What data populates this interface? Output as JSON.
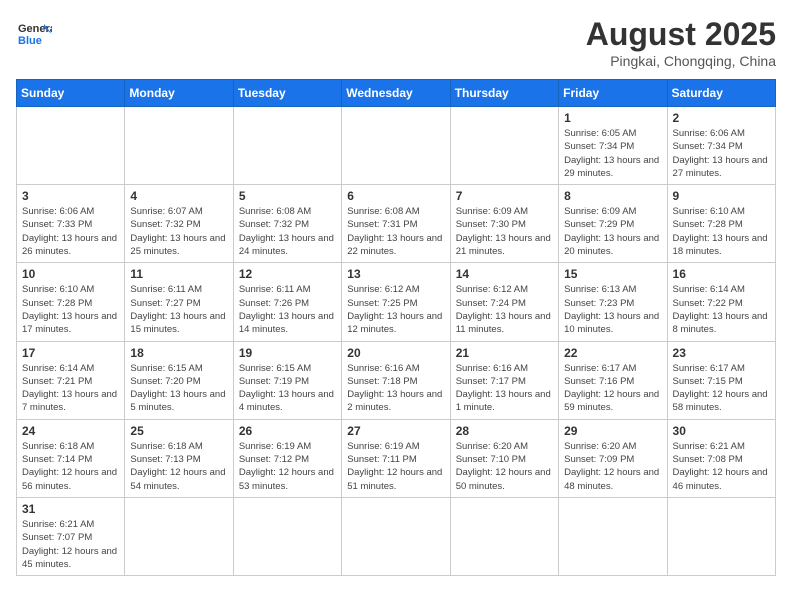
{
  "logo": {
    "text_general": "General",
    "text_blue": "Blue"
  },
  "header": {
    "title": "August 2025",
    "subtitle": "Pingkai, Chongqing, China"
  },
  "weekdays": [
    "Sunday",
    "Monday",
    "Tuesday",
    "Wednesday",
    "Thursday",
    "Friday",
    "Saturday"
  ],
  "days": [
    {
      "date": "",
      "info": ""
    },
    {
      "date": "",
      "info": ""
    },
    {
      "date": "",
      "info": ""
    },
    {
      "date": "",
      "info": ""
    },
    {
      "date": "",
      "info": ""
    },
    {
      "date": "1",
      "info": "Sunrise: 6:05 AM\nSunset: 7:34 PM\nDaylight: 13 hours and 29 minutes."
    },
    {
      "date": "2",
      "info": "Sunrise: 6:06 AM\nSunset: 7:34 PM\nDaylight: 13 hours and 27 minutes."
    },
    {
      "date": "3",
      "info": "Sunrise: 6:06 AM\nSunset: 7:33 PM\nDaylight: 13 hours and 26 minutes."
    },
    {
      "date": "4",
      "info": "Sunrise: 6:07 AM\nSunset: 7:32 PM\nDaylight: 13 hours and 25 minutes."
    },
    {
      "date": "5",
      "info": "Sunrise: 6:08 AM\nSunset: 7:32 PM\nDaylight: 13 hours and 24 minutes."
    },
    {
      "date": "6",
      "info": "Sunrise: 6:08 AM\nSunset: 7:31 PM\nDaylight: 13 hours and 22 minutes."
    },
    {
      "date": "7",
      "info": "Sunrise: 6:09 AM\nSunset: 7:30 PM\nDaylight: 13 hours and 21 minutes."
    },
    {
      "date": "8",
      "info": "Sunrise: 6:09 AM\nSunset: 7:29 PM\nDaylight: 13 hours and 20 minutes."
    },
    {
      "date": "9",
      "info": "Sunrise: 6:10 AM\nSunset: 7:28 PM\nDaylight: 13 hours and 18 minutes."
    },
    {
      "date": "10",
      "info": "Sunrise: 6:10 AM\nSunset: 7:28 PM\nDaylight: 13 hours and 17 minutes."
    },
    {
      "date": "11",
      "info": "Sunrise: 6:11 AM\nSunset: 7:27 PM\nDaylight: 13 hours and 15 minutes."
    },
    {
      "date": "12",
      "info": "Sunrise: 6:11 AM\nSunset: 7:26 PM\nDaylight: 13 hours and 14 minutes."
    },
    {
      "date": "13",
      "info": "Sunrise: 6:12 AM\nSunset: 7:25 PM\nDaylight: 13 hours and 12 minutes."
    },
    {
      "date": "14",
      "info": "Sunrise: 6:12 AM\nSunset: 7:24 PM\nDaylight: 13 hours and 11 minutes."
    },
    {
      "date": "15",
      "info": "Sunrise: 6:13 AM\nSunset: 7:23 PM\nDaylight: 13 hours and 10 minutes."
    },
    {
      "date": "16",
      "info": "Sunrise: 6:14 AM\nSunset: 7:22 PM\nDaylight: 13 hours and 8 minutes."
    },
    {
      "date": "17",
      "info": "Sunrise: 6:14 AM\nSunset: 7:21 PM\nDaylight: 13 hours and 7 minutes."
    },
    {
      "date": "18",
      "info": "Sunrise: 6:15 AM\nSunset: 7:20 PM\nDaylight: 13 hours and 5 minutes."
    },
    {
      "date": "19",
      "info": "Sunrise: 6:15 AM\nSunset: 7:19 PM\nDaylight: 13 hours and 4 minutes."
    },
    {
      "date": "20",
      "info": "Sunrise: 6:16 AM\nSunset: 7:18 PM\nDaylight: 13 hours and 2 minutes."
    },
    {
      "date": "21",
      "info": "Sunrise: 6:16 AM\nSunset: 7:17 PM\nDaylight: 13 hours and 1 minute."
    },
    {
      "date": "22",
      "info": "Sunrise: 6:17 AM\nSunset: 7:16 PM\nDaylight: 12 hours and 59 minutes."
    },
    {
      "date": "23",
      "info": "Sunrise: 6:17 AM\nSunset: 7:15 PM\nDaylight: 12 hours and 58 minutes."
    },
    {
      "date": "24",
      "info": "Sunrise: 6:18 AM\nSunset: 7:14 PM\nDaylight: 12 hours and 56 minutes."
    },
    {
      "date": "25",
      "info": "Sunrise: 6:18 AM\nSunset: 7:13 PM\nDaylight: 12 hours and 54 minutes."
    },
    {
      "date": "26",
      "info": "Sunrise: 6:19 AM\nSunset: 7:12 PM\nDaylight: 12 hours and 53 minutes."
    },
    {
      "date": "27",
      "info": "Sunrise: 6:19 AM\nSunset: 7:11 PM\nDaylight: 12 hours and 51 minutes."
    },
    {
      "date": "28",
      "info": "Sunrise: 6:20 AM\nSunset: 7:10 PM\nDaylight: 12 hours and 50 minutes."
    },
    {
      "date": "29",
      "info": "Sunrise: 6:20 AM\nSunset: 7:09 PM\nDaylight: 12 hours and 48 minutes."
    },
    {
      "date": "30",
      "info": "Sunrise: 6:21 AM\nSunset: 7:08 PM\nDaylight: 12 hours and 46 minutes."
    },
    {
      "date": "31",
      "info": "Sunrise: 6:21 AM\nSunset: 7:07 PM\nDaylight: 12 hours and 45 minutes."
    }
  ]
}
